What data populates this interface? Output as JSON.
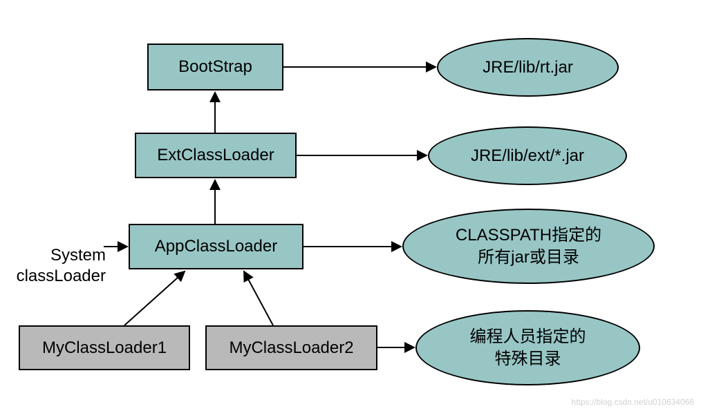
{
  "nodes": {
    "bootstrap": "BootStrap",
    "extclassloader": "ExtClassLoader",
    "appclassloader": "AppClassLoader",
    "myclassloader1": "MyClassLoader1",
    "myclassloader2": "MyClassLoader2"
  },
  "ellipses": {
    "rtjar": "JRE/lib/rt.jar",
    "extjar": "JRE/lib/ext/*.jar",
    "classpath": "CLASSPATH指定的\n所有jar或目录",
    "custompaths": "编程人员指定的\n特殊目录"
  },
  "labels": {
    "system": "System\nclassLoader"
  },
  "watermark": "https://blog.csdn.net/u010634066",
  "chart_data": {
    "type": "diagram",
    "title": "Java ClassLoader Hierarchy",
    "nodes": [
      {
        "id": "bootstrap",
        "label": "BootStrap",
        "shape": "rect",
        "color": "teal"
      },
      {
        "id": "extclassloader",
        "label": "ExtClassLoader",
        "shape": "rect",
        "color": "teal"
      },
      {
        "id": "appclassloader",
        "label": "AppClassLoader",
        "shape": "rect",
        "color": "teal",
        "alias": "System classLoader"
      },
      {
        "id": "myclassloader1",
        "label": "MyClassLoader1",
        "shape": "rect",
        "color": "gray"
      },
      {
        "id": "myclassloader2",
        "label": "MyClassLoader2",
        "shape": "rect",
        "color": "gray"
      },
      {
        "id": "rtjar",
        "label": "JRE/lib/rt.jar",
        "shape": "ellipse",
        "color": "teal"
      },
      {
        "id": "extjar",
        "label": "JRE/lib/ext/*.jar",
        "shape": "ellipse",
        "color": "teal"
      },
      {
        "id": "classpath",
        "label": "CLASSPATH指定的所有jar或目录",
        "shape": "ellipse",
        "color": "teal"
      },
      {
        "id": "custompaths",
        "label": "编程人员指定的特殊目录",
        "shape": "ellipse",
        "color": "teal"
      }
    ],
    "edges": [
      {
        "from": "extclassloader",
        "to": "bootstrap",
        "kind": "parent"
      },
      {
        "from": "appclassloader",
        "to": "extclassloader",
        "kind": "parent"
      },
      {
        "from": "myclassloader1",
        "to": "appclassloader",
        "kind": "parent"
      },
      {
        "from": "myclassloader2",
        "to": "appclassloader",
        "kind": "parent"
      },
      {
        "from": "bootstrap",
        "to": "rtjar",
        "kind": "loads"
      },
      {
        "from": "extclassloader",
        "to": "extjar",
        "kind": "loads"
      },
      {
        "from": "appclassloader",
        "to": "classpath",
        "kind": "loads"
      },
      {
        "from": "myclassloader2",
        "to": "custompaths",
        "kind": "loads"
      },
      {
        "from": "system_label",
        "to": "appclassloader",
        "kind": "alias"
      }
    ]
  }
}
